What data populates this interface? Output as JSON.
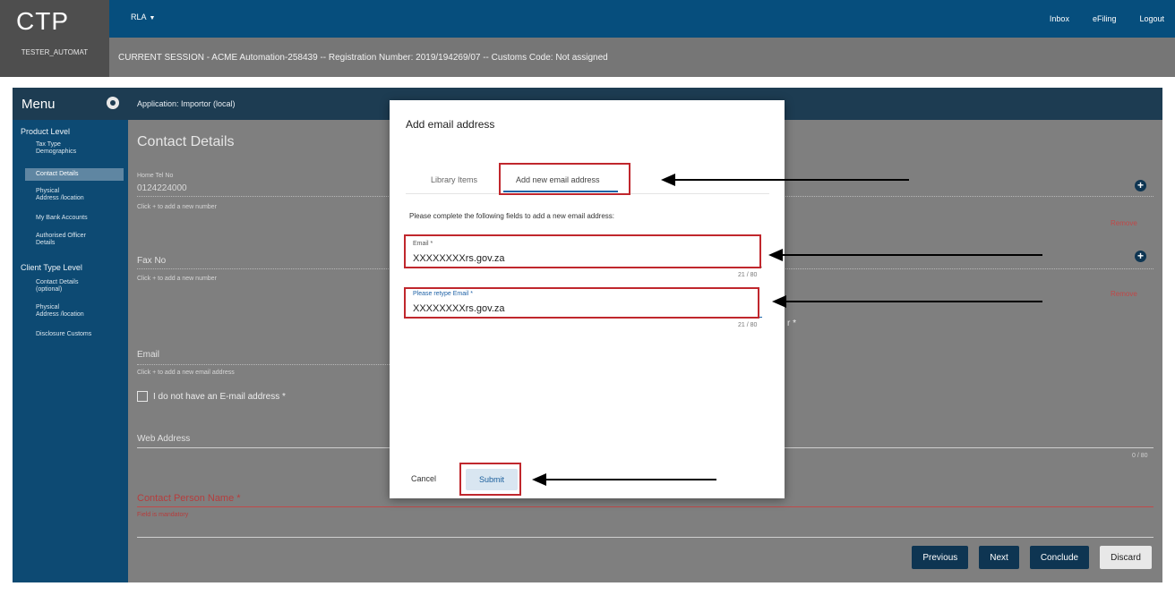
{
  "header": {
    "logo": "CTP",
    "user": "TESTER_AUTOMAT",
    "app_selector": "RLA",
    "links": [
      "Inbox",
      "eFiling",
      "Logout"
    ],
    "session": "CURRENT SESSION - ACME Automation-258439 -- Registration Number: 2019/194269/07 -- Customs Code: Not assigned"
  },
  "menu": {
    "title": "Menu",
    "product_level": "Product Level",
    "product_items": [
      "Tax Type\nDemographics",
      "Contact Details",
      "Physical\nAddress /location",
      "My Bank Accounts",
      "Authorised Officer\nDetails"
    ],
    "client_level": "Client Type Level",
    "client_items": [
      "Contact Details\n(optional)",
      "Physical\nAddress /location",
      "Disclosure Customs"
    ]
  },
  "main": {
    "app_title": "Application: Importor (local)",
    "page_title": "Contact Details",
    "home_tel_label": "Home Tel No",
    "home_tel_value": "0124224000",
    "add_number_hint": "Click + to add a new number",
    "fax_label": "Fax No",
    "fax_hint": "Click + to add a new number",
    "email_label": "Email",
    "email_hint": "Click + to add a new email address",
    "no_email_label": "I do not have an E-mail address *",
    "web_label": "Web Address",
    "web_counter": "0 / 80",
    "contact_person_label": "Contact Person Name *",
    "field_mandatory": "Field is mandatory",
    "remove_label": "Remove",
    "partial_label": "r *",
    "buttons": [
      "Previous",
      "Next",
      "Conclude",
      "Discard"
    ]
  },
  "modal": {
    "title": "Add email address",
    "tab_library": "Library Items",
    "tab_add_new": "Add new email address",
    "instructions": "Please complete the following fields to add a new email address:",
    "email_label": "Email *",
    "email_value": "XXXXXXXXrs.gov.za",
    "email_counter": "21 / 80",
    "retype_label": "Please retype Email *",
    "retype_value": "XXXXXXXXrs.gov.za",
    "retype_counter": "21 / 80",
    "cancel": "Cancel",
    "submit": "Submit"
  },
  "colors": {
    "header_blue": "#064e7d",
    "menu_blue": "#0d4a73",
    "highlight_red": "#c0272d",
    "mandatory_red": "#b63d3d"
  }
}
